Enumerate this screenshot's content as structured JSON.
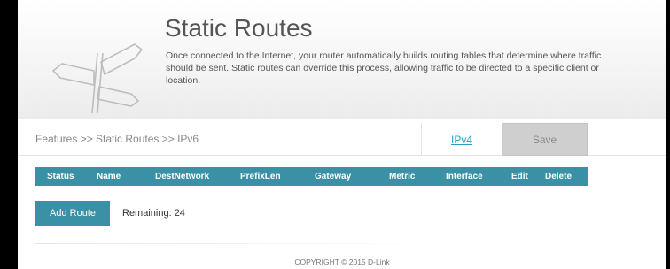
{
  "header": {
    "title": "Static Routes",
    "description": "Once connected to the Internet, your router automatically builds routing tables that determine where traffic should be sent. Static routes can override this process, allowing traffic to be directed to a specific client or location.",
    "icon": "signpost-icon"
  },
  "nav": {
    "breadcrumb": "Features >> Static Routes >> IPv6",
    "ipv4_link": "IPv4",
    "save_label": "Save"
  },
  "table": {
    "columns": [
      "Status",
      "Name",
      "DestNetwork",
      "PrefixLen",
      "Gateway",
      "Metric",
      "Interface",
      "Edit",
      "Delete"
    ],
    "rows": []
  },
  "actions": {
    "add_route_label": "Add Route",
    "remaining_label": "Remaining:",
    "remaining_count": "24"
  },
  "footer": {
    "copyright": "COPYRIGHT © 2015 D-Link"
  },
  "colors": {
    "accent": "#3a90a4",
    "link": "#2a9fbf",
    "save_bg": "#cfcfcf"
  }
}
